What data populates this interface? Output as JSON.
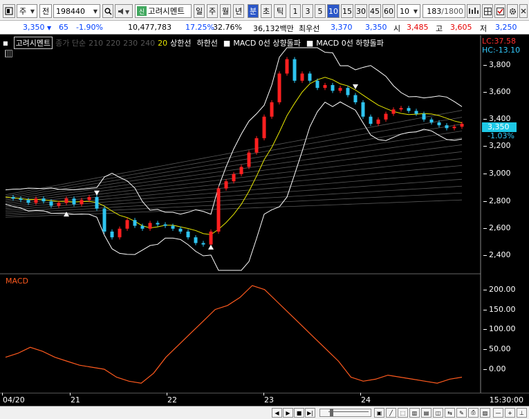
{
  "toolbar": {
    "market": "주",
    "range": "전",
    "code": "198440",
    "stock_badge": "신",
    "stock_name": "고려시멘트",
    "periods": [
      "일",
      "주",
      "월",
      "년",
      "분",
      "초",
      "틱"
    ],
    "active_period": "분",
    "intervals": [
      "1",
      "3",
      "5",
      "10",
      "15",
      "30",
      "45",
      "60"
    ],
    "active_interval": "10",
    "interval_value": "10",
    "count_value": "183",
    "count_total": "/1800"
  },
  "quote": {
    "price": "3,350",
    "change": "65",
    "change_rate": "-1.90%",
    "volume": "10,477,783",
    "rate1": "17.25%",
    "rate2": "32.76%",
    "amount": "36,132백만",
    "pref_label": "최우선",
    "ask": "3,370",
    "bid": "3,350",
    "open_label": "시",
    "open": "3,485",
    "high_label": "고",
    "high": "3,605",
    "low_label": "저",
    "low": "3,250"
  },
  "legend": {
    "name": "고려시멘트",
    "ma_label": "종가 단순",
    "ma_periods": [
      "210",
      "220",
      "230",
      "240"
    ],
    "ma20": "20",
    "upper": "상한선",
    "lower": "하한선",
    "macd_up": "MACD 0선 상향돌파",
    "macd_down": "MACD 0선 하향돌파"
  },
  "price_axis": {
    "lc": "LC:37.58",
    "hc": "HC:-13.10",
    "ticks": [
      "3,800",
      "3,600",
      "3,400",
      "3,000",
      "2,800",
      "2,600",
      "2,400"
    ],
    "tick_3200": "3,200",
    "current": "3,350",
    "current_change": "-1.03%"
  },
  "macd": {
    "label": "MACD",
    "ticks": [
      "200.00",
      "150.00",
      "100.00",
      "50.00",
      "0.00"
    ]
  },
  "xaxis": {
    "labels": [
      "04/20",
      "21",
      "22",
      "23",
      "24"
    ],
    "time": "15:30:00"
  },
  "colors": {
    "up": "#ff2020",
    "down": "#2ec4f0",
    "ma20": "#e8e800",
    "band": "#ffffff",
    "macd": "#ff5a1e"
  },
  "chart_data": {
    "type": "candlestick",
    "ylim": [
      2330,
      3880
    ],
    "series": [
      {
        "name": "close_approx",
        "values": [
          2840,
          2830,
          2820,
          2800,
          2830,
          2810,
          2780,
          2800,
          2830,
          2790,
          2820,
          2840,
          2760,
          2600,
          2560,
          2620,
          2680,
          2640,
          2620,
          2660,
          2650,
          2640,
          2620,
          2600,
          2560,
          2520,
          2510,
          2600,
          2900,
          2950,
          3000,
          3050,
          3150,
          3250,
          3400,
          3500,
          3700,
          3800,
          3650,
          3700,
          3650,
          3600,
          3620,
          3580,
          3600,
          3550,
          3500,
          3400,
          3350,
          3380,
          3420,
          3450,
          3460,
          3440,
          3420,
          3380,
          3360,
          3340,
          3320,
          3330,
          3350
        ]
      }
    ],
    "macd_values": [
      30,
      40,
      55,
      45,
      30,
      20,
      10,
      5,
      0,
      -20,
      -30,
      -35,
      -10,
      30,
      60,
      90,
      120,
      150,
      160,
      180,
      210,
      200,
      170,
      140,
      110,
      80,
      50,
      20,
      -20,
      -30,
      -25,
      -15,
      -20,
      -25,
      -30,
      -35,
      -25,
      -20
    ]
  }
}
